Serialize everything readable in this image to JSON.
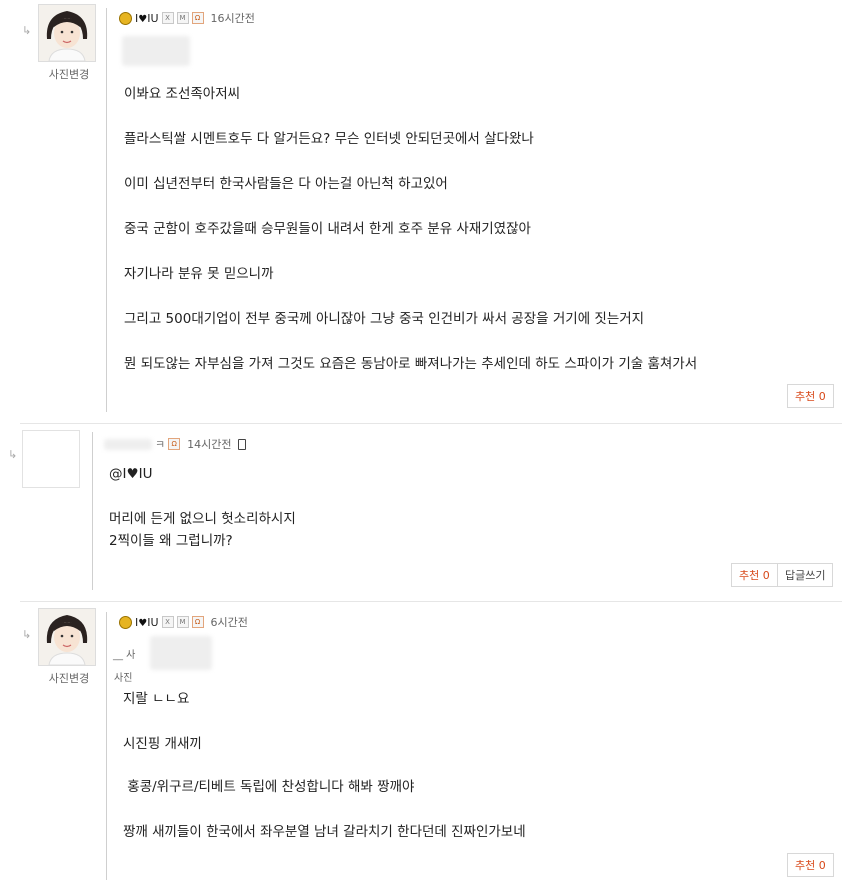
{
  "comments": [
    {
      "nick": "I",
      "nick2": "IU",
      "time": "16시간전",
      "photo_label": "사진변경",
      "lines": [
        "이봐요 조선족아저씨",
        "플라스틱쌀 시멘트호두 다 알거든요? 무슨 인터넷 안되던곳에서 살다왔나",
        "이미 십년전부터 한국사람들은 다 아는걸 아닌척 하고있어",
        "중국 군함이 호주갔을때 승무원들이 내려서 한게 호주 분유 사재기였잖아",
        "자기나라 분유 못 믿으니까",
        "그리고 500대기업이 전부 중국께 아니잖아 그냥 중국 인건비가 싸서 공장을 거기에 짓는거지",
        "뭔 되도않는 자부심을 가져 그것도 요즘은 동남아로 빠져나가는 추세인데 하도 스파이가 기술 훔쳐가서"
      ],
      "recommend": "추천 0"
    },
    {
      "nick_suffix": "ㅋ",
      "time": "14시간전",
      "lines": [
        "@I♥IU",
        "",
        "머리에 든게 없으니 헛소리하시지",
        "2찍이들 왜 그럽니까?"
      ],
      "recommend": "추천 0",
      "reply": "답글쓰기"
    },
    {
      "nick": "I",
      "nick2": "IU",
      "time": "6시간전",
      "photo_label": "사진변경",
      "quoted_a": "__ 사",
      "quoted_b": "사진",
      "lines": [
        "지랄 ㄴㄴ요",
        "시진핑 개새끼",
        " 홍콩/위구르/티베트 독립에 찬성합니다 해봐 짱깨야",
        "짱깨 새끼들이 한국에서 좌우분열 남녀 갈라치기 한다던데 진짜인가보네"
      ],
      "recommend": "추천 0"
    }
  ],
  "reply_arrow": "↳",
  "heart": "♥",
  "icons": [
    "level-badge-icon",
    "x-icon",
    "m-icon",
    "rank-icon",
    "phone-icon",
    "avatar-girl-icon"
  ]
}
